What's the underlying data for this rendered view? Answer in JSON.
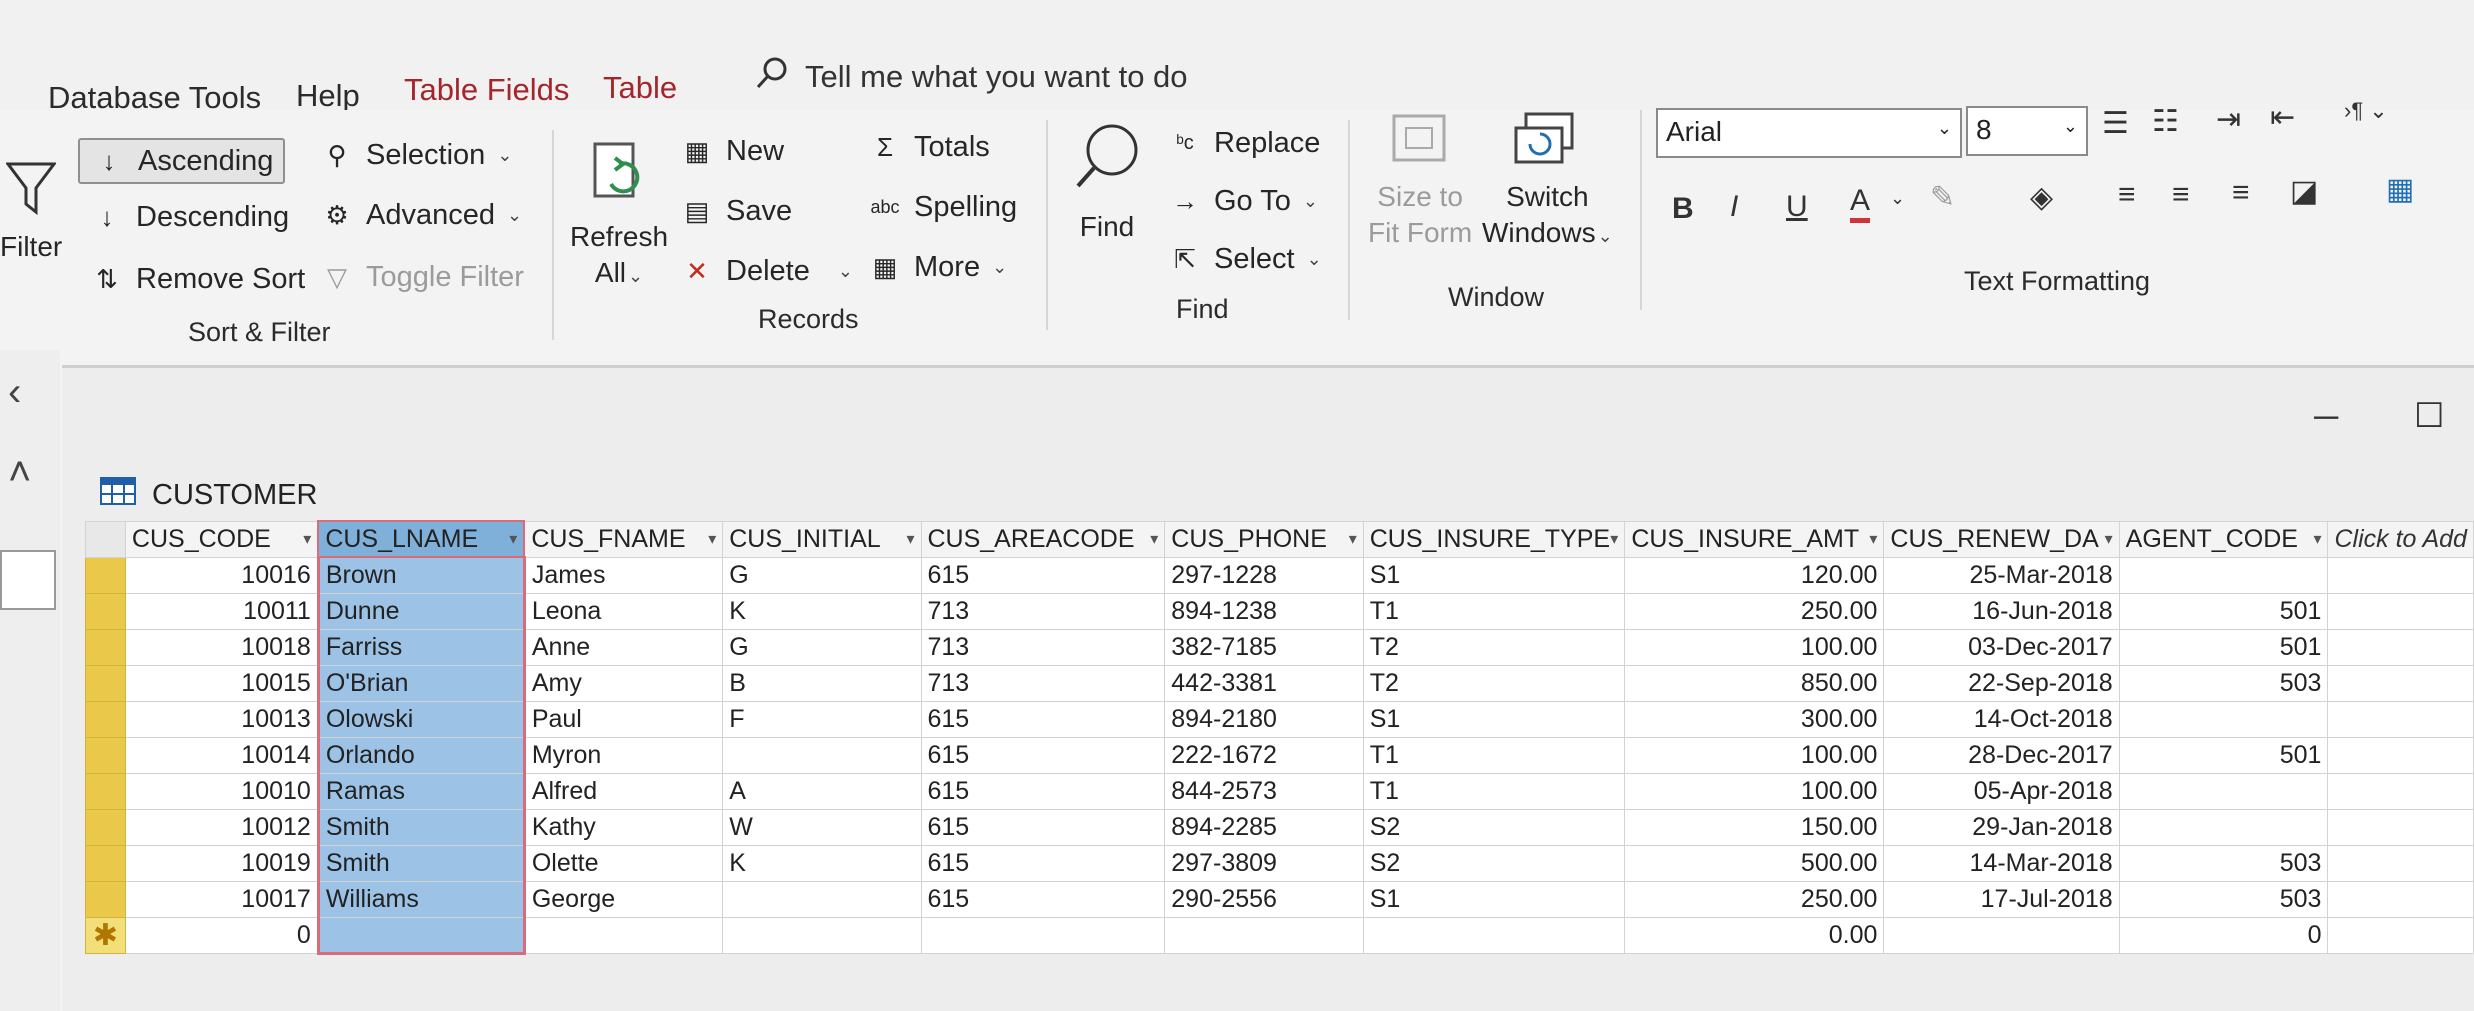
{
  "tabs": [
    "Database Tools",
    "Help",
    "Table Fields",
    "Table"
  ],
  "tell_me": "Tell me what you want to do",
  "sort_filter": {
    "filter_label": "Filter",
    "ascending": "Ascending",
    "descending": "Descending",
    "remove_sort": "Remove Sort",
    "selection": "Selection",
    "advanced": "Advanced",
    "toggle_filter": "Toggle Filter",
    "group": "Sort & Filter"
  },
  "records": {
    "refresh_line1": "Refresh",
    "refresh_line2": "All",
    "new": "New",
    "save": "Save",
    "delete": "Delete",
    "totals": "Totals",
    "spelling": "Spelling",
    "more": "More",
    "group": "Records"
  },
  "find": {
    "find": "Find",
    "replace": "Replace",
    "goto": "Go To",
    "select": "Select",
    "group": "Find"
  },
  "window": {
    "size_line1": "Size to",
    "size_line2": "Fit Form",
    "switch_line1": "Switch",
    "switch_line2": "Windows",
    "group": "Window"
  },
  "text_formatting": {
    "font": "Arial",
    "size": "8",
    "bold": "B",
    "italic": "I",
    "underline": "U",
    "font_color": "A",
    "group": "Text Formatting"
  },
  "table": {
    "name": "CUSTOMER",
    "columns": [
      "CUS_CODE",
      "CUS_LNAME",
      "CUS_FNAME",
      "CUS_INITIAL",
      "CUS_AREACODE",
      "CUS_PHONE",
      "CUS_INSURE_TYPE",
      "CUS_INSURE_AMT",
      "CUS_RENEW_DA",
      "AGENT_CODE",
      "Click to Add"
    ],
    "rows": [
      [
        "10016",
        "Brown",
        "James",
        "G",
        "615",
        "297-1228",
        "S1",
        "120.00",
        "25-Mar-2018",
        ""
      ],
      [
        "10011",
        "Dunne",
        "Leona",
        "K",
        "713",
        "894-1238",
        "T1",
        "250.00",
        "16-Jun-2018",
        "501"
      ],
      [
        "10018",
        "Farriss",
        "Anne",
        "G",
        "713",
        "382-7185",
        "T2",
        "100.00",
        "03-Dec-2017",
        "501"
      ],
      [
        "10015",
        "O'Brian",
        "Amy",
        "B",
        "713",
        "442-3381",
        "T2",
        "850.00",
        "22-Sep-2018",
        "503"
      ],
      [
        "10013",
        "Olowski",
        "Paul",
        "F",
        "615",
        "894-2180",
        "S1",
        "300.00",
        "14-Oct-2018",
        ""
      ],
      [
        "10014",
        "Orlando",
        "Myron",
        "",
        "615",
        "222-1672",
        "T1",
        "100.00",
        "28-Dec-2017",
        "501"
      ],
      [
        "10010",
        "Ramas",
        "Alfred",
        "A",
        "615",
        "844-2573",
        "T1",
        "100.00",
        "05-Apr-2018",
        ""
      ],
      [
        "10012",
        "Smith",
        "Kathy",
        "W",
        "615",
        "894-2285",
        "S2",
        "150.00",
        "29-Jan-2018",
        ""
      ],
      [
        "10019",
        "Smith",
        "Olette",
        "K",
        "615",
        "297-3809",
        "S2",
        "500.00",
        "14-Mar-2018",
        "503"
      ],
      [
        "10017",
        "Williams",
        "George",
        "",
        "615",
        "290-2556",
        "S1",
        "250.00",
        "17-Jul-2018",
        "503"
      ]
    ],
    "new_row": [
      "0",
      "",
      "",
      "",
      "",
      "",
      "",
      "0.00",
      "",
      "0"
    ]
  },
  "colors": {
    "accent": "#a4262c",
    "selection": "#9cc3e6",
    "row_selector": "#e9c84a"
  }
}
